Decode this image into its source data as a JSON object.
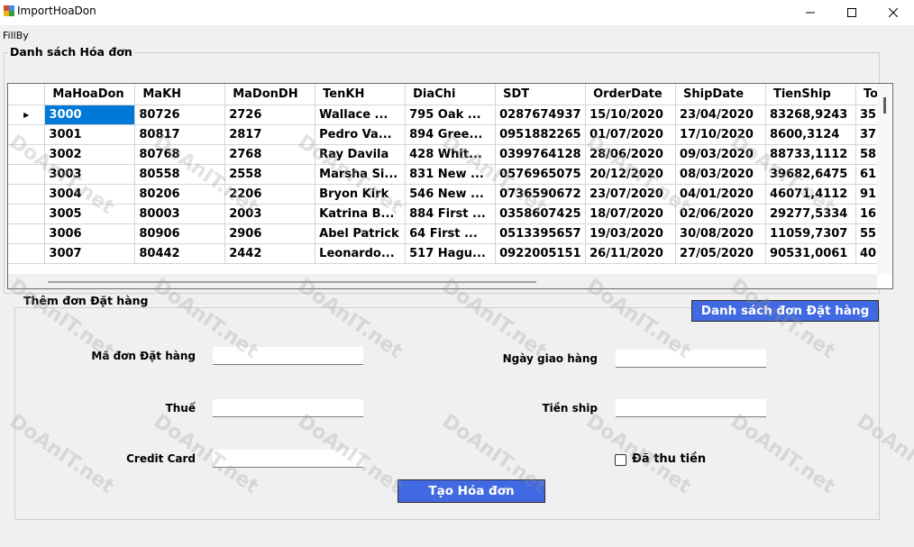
{
  "window": {
    "title": "ImportHoaDon",
    "minimize_icon": "minimize-icon",
    "maximize_icon": "maximize-icon",
    "close_icon": "close-icon"
  },
  "menu": {
    "items": [
      "FillBy"
    ]
  },
  "list_group": {
    "label": "Danh sách Hóa đơn"
  },
  "grid": {
    "columns": [
      "MaHoaDon",
      "MaKH",
      "MaDonDH",
      "TenKH",
      "DiaChi",
      "SDT",
      "OrderDate",
      "ShipDate",
      "TienShip",
      "To"
    ],
    "rows": [
      [
        "3000",
        "80726",
        "2726",
        "Wallace ...",
        "795 Oak ...",
        "0287674937",
        "15/10/2020",
        "23/04/2020",
        "83268,9243",
        "35"
      ],
      [
        "3001",
        "80817",
        "2817",
        "Pedro Va...",
        "894 Gree...",
        "0951882265",
        "01/07/2020",
        "17/10/2020",
        "8600,3124",
        "37"
      ],
      [
        "3002",
        "80768",
        "2768",
        "Ray Davila",
        "428 Whit...",
        "0399764128",
        "28/06/2020",
        "09/03/2020",
        "88733,1112",
        "58"
      ],
      [
        "3003",
        "80558",
        "2558",
        "Marsha Si...",
        "831 New ...",
        "0576965075",
        "20/12/2020",
        "08/03/2020",
        "39682,6475",
        "61"
      ],
      [
        "3004",
        "80206",
        "2206",
        "Bryon Kirk",
        "546 New ...",
        "0736590672",
        "23/07/2020",
        "04/01/2020",
        "46071,4112",
        "91"
      ],
      [
        "3005",
        "80003",
        "2003",
        "Katrina B...",
        "884 First ...",
        "0358607425",
        "18/07/2020",
        "02/06/2020",
        "29277,5334",
        "16"
      ],
      [
        "3006",
        "80906",
        "2906",
        "Abel Patrick",
        "64 First ...",
        "0513395657",
        "19/03/2020",
        "30/08/2020",
        "11059,7307",
        "55"
      ],
      [
        "3007",
        "80442",
        "2442",
        "Leonardo...",
        "517 Hagu...",
        "0922005151",
        "26/11/2020",
        "27/05/2020",
        "90531,0061",
        "40"
      ]
    ],
    "current_row_icon": "row-pointer-icon"
  },
  "form_group": {
    "label": "Thêm đơn Đặt hàng",
    "list_button": "Danh sách đơn Đặt hàng",
    "fields": {
      "ma_don_dat_hang": {
        "label": "Mã đơn Đặt hàng",
        "value": ""
      },
      "ngay_giao_hang": {
        "label": "Ngày giao hàng",
        "value": ""
      },
      "thue": {
        "label": "Thuế",
        "value": ""
      },
      "tien_ship": {
        "label": "Tiền ship",
        "value": ""
      },
      "credit_card": {
        "label": "Credit Card",
        "value": ""
      }
    },
    "paid_checkbox": {
      "label": "Đã thu tiền",
      "checked": false
    },
    "create_button": "Tạo Hóa đơn"
  },
  "watermark": {
    "text": "DoAnIT.net"
  },
  "colors": {
    "selection": "#0078d7",
    "button": "#4169e1"
  }
}
